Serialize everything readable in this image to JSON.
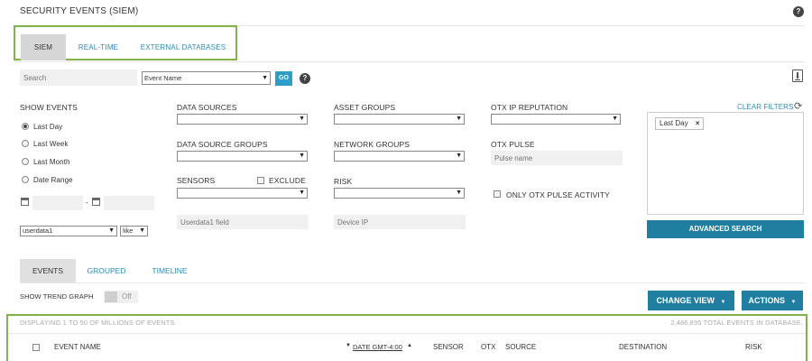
{
  "page": {
    "title": "SECURITY EVENTS (SIEM)",
    "help": "?"
  },
  "top_tabs": [
    {
      "label": "SIEM"
    },
    {
      "label": "REAL-TIME"
    },
    {
      "label": "EXTERNAL DATABASES"
    }
  ],
  "search": {
    "placeholder": "Search",
    "field_select": "Event Name",
    "go_label": "GO",
    "help": "?"
  },
  "show_events": {
    "heading": "SHOW EVENTS",
    "options": [
      "Last Day",
      "Last Week",
      "Last Month",
      "Date Range"
    ],
    "selected": "Last Day",
    "date_separator": "-"
  },
  "userdata": {
    "field_select": "userdata1",
    "operator_select": "like",
    "input_placeholder": "Userdata1 field"
  },
  "filters": {
    "data_sources": "DATA SOURCES",
    "data_source_groups": "DATA SOURCE GROUPS",
    "sensors": "SENSORS",
    "exclude": "EXCLUDE",
    "asset_groups": "ASSET GROUPS",
    "network_groups": "NETWORK GROUPS",
    "risk": "RISK",
    "device_ip_placeholder": "Device IP",
    "otx_ip_reputation": "OTX IP REPUTATION",
    "otx_pulse": "OTX PULSE",
    "pulse_name_placeholder": "Pulse name",
    "only_otx_pulse_activity": "ONLY OTX PULSE ACTIVITY"
  },
  "active_filters": {
    "clear_label": "CLEAR FILTERS",
    "chips": [
      {
        "label": "Last Day",
        "remove": "×"
      }
    ],
    "advanced_search": "ADVANCED SEARCH"
  },
  "lower_tabs": [
    {
      "label": "EVENTS"
    },
    {
      "label": "GROUPED"
    },
    {
      "label": "TIMELINE"
    }
  ],
  "trend": {
    "label": "SHOW TREND GRAPH",
    "toggle_text": "Off"
  },
  "actions": {
    "change_view": "CHANGE VIEW",
    "actions": "ACTIONS",
    "caret": "▼"
  },
  "results": {
    "displaying": "DISPLAYING 1 TO 50 OF MILLIONS OF EVENTS.",
    "total": "2,486,895 TOTAL EVENTS IN DATABASE.",
    "columns": {
      "event_name": "EVENT NAME",
      "date": "DATE GMT-4:00",
      "sensor": "SENSOR",
      "otx": "OTX",
      "source": "SOURCE",
      "destination": "DESTINATION",
      "risk": "RISK"
    }
  },
  "colors": {
    "accent": "#2e8bb8",
    "button": "#207fa0",
    "highlight": "#80b44a"
  }
}
